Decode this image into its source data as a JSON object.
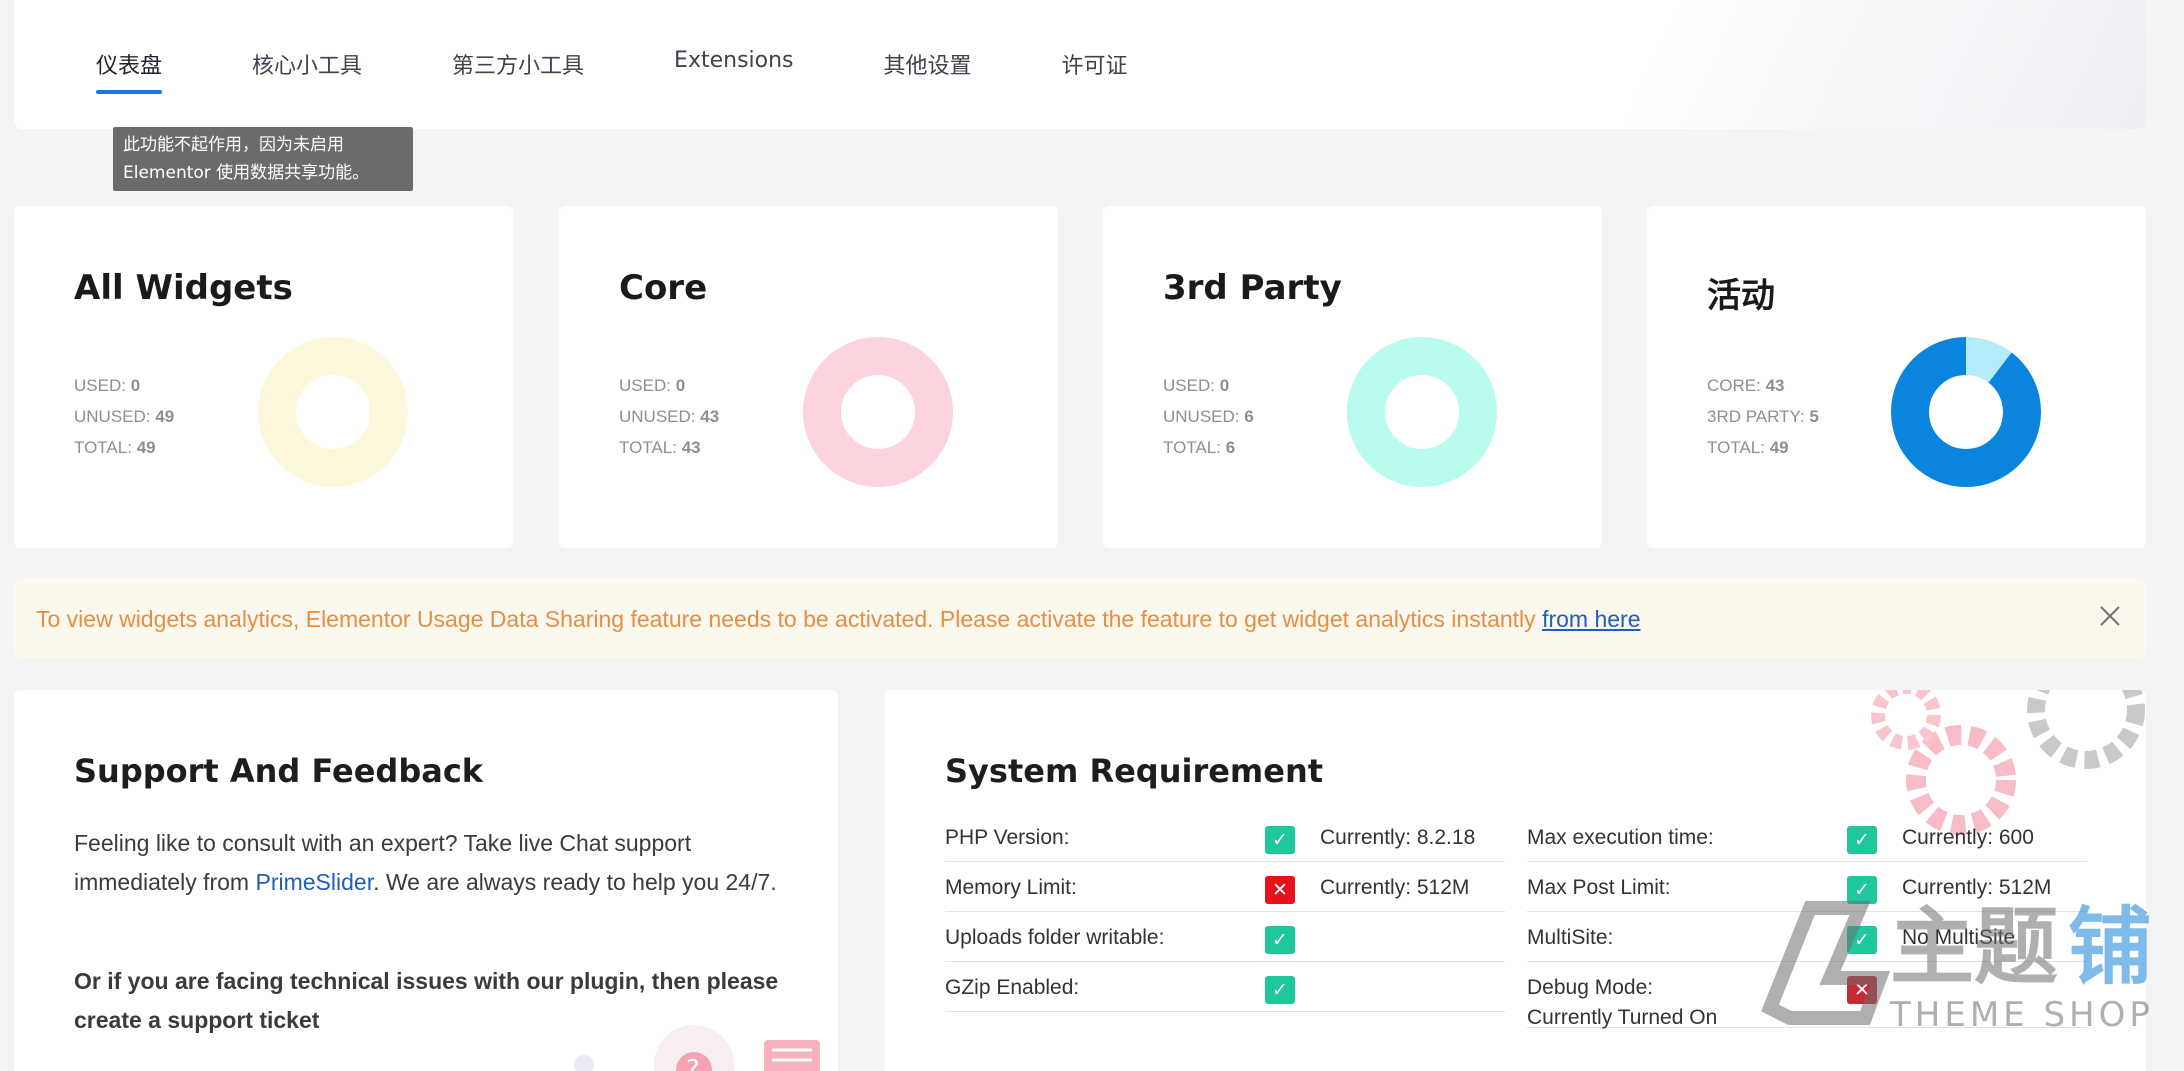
{
  "tabs": [
    {
      "label": "仪表盘",
      "active": true
    },
    {
      "label": "核心小工具"
    },
    {
      "label": "第三方小工具"
    },
    {
      "label": "Extensions"
    },
    {
      "label": "其他设置"
    },
    {
      "label": "许可证"
    }
  ],
  "tooltip": {
    "line1": "此功能不起作用，因为未启用",
    "line2": "Elementor 使用数据共享功能。"
  },
  "cards": [
    {
      "title": "All Widgets",
      "rows": [
        {
          "k": "USED:",
          "v": "0"
        },
        {
          "k": "UNUSED:",
          "v": "49"
        },
        {
          "k": "TOTAL:",
          "v": "49"
        }
      ],
      "color": "#fdf8dc"
    },
    {
      "title": "Core",
      "rows": [
        {
          "k": "USED:",
          "v": "0"
        },
        {
          "k": "UNUSED:",
          "v": "43"
        },
        {
          "k": "TOTAL:",
          "v": "43"
        }
      ],
      "color": "#fdd4de"
    },
    {
      "title": "3rd Party",
      "rows": [
        {
          "k": "USED:",
          "v": "0"
        },
        {
          "k": "UNUSED:",
          "v": "6"
        },
        {
          "k": "TOTAL:",
          "v": "6"
        }
      ],
      "color": "#b9fbef"
    },
    {
      "title": "活动",
      "rows": [
        {
          "k": "CORE:",
          "v": "43"
        },
        {
          "k": "3RD PARTY:",
          "v": "5"
        },
        {
          "k": "TOTAL:",
          "v": "49"
        }
      ],
      "core_color": "#0a84dd",
      "third_color": "#b4ecfb",
      "core_value": 43,
      "third_value": 5
    }
  ],
  "notice": {
    "text": "To view widgets analytics, Elementor Usage Data Sharing feature needs to be activated. Please activate the feature to get widget analytics instantly ",
    "link": "from here"
  },
  "support": {
    "title": "Support And Feedback",
    "p1_before": "Feeling like to consult with an expert? Take live Chat support immediately from ",
    "p1_link": "PrimeSlider",
    "p1_after": ". We are always ready to help you 24/7.",
    "p2": "Or if you are facing technical issues with our plugin, then please create a support ticket"
  },
  "system": {
    "title": "System Requirement",
    "left": [
      {
        "label": "PHP Version:",
        "status": "ok",
        "current": "Currently: 8.2.18"
      },
      {
        "label": "Memory Limit:",
        "status": "bad",
        "current": "Currently: 512M"
      },
      {
        "label": "Uploads folder writable:",
        "status": "ok",
        "current": ""
      },
      {
        "label": "GZip Enabled:",
        "status": "ok",
        "current": ""
      }
    ],
    "right": [
      {
        "label": "Max execution time:",
        "status": "ok",
        "current": "Currently: 600"
      },
      {
        "label": "Max Post Limit:",
        "status": "ok",
        "current": "Currently: 512M"
      },
      {
        "label": "MultiSite:",
        "status": "ok",
        "current": "No MultiSite"
      },
      {
        "label": "Debug Mode:",
        "status": "bad",
        "current": "",
        "sub": "Currently Turned On"
      }
    ]
  },
  "watermark": {
    "cn": "主题铺",
    "en": "THEME SHOP"
  }
}
